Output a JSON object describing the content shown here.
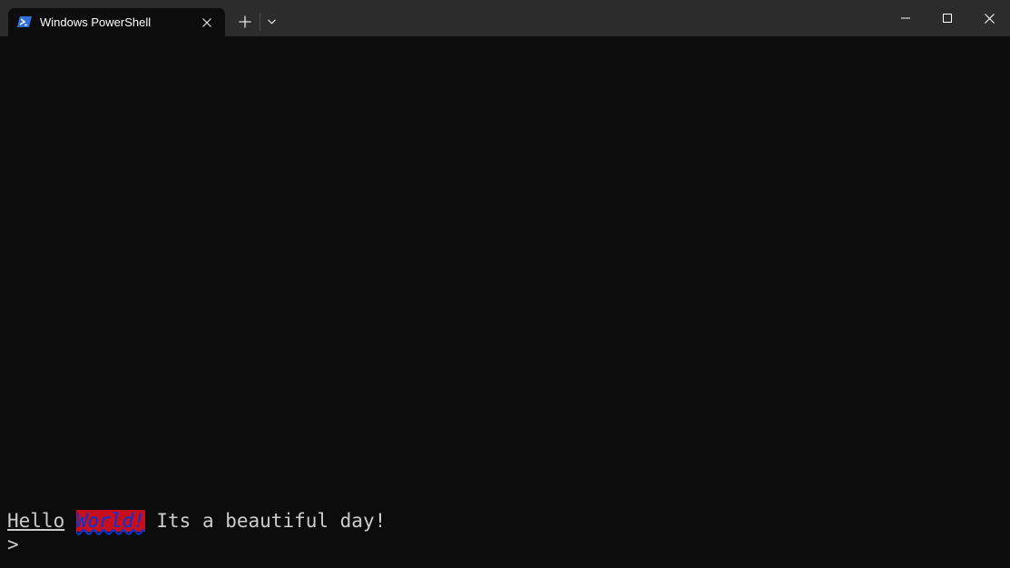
{
  "window": {
    "tab_title": "Windows PowerShell",
    "tab_icon": "powershell-icon"
  },
  "terminal": {
    "line1": {
      "hello": "Hello",
      "space1": " ",
      "world": "World!",
      "rest": " Its a beautiful day!"
    },
    "prompt": ">"
  },
  "colors": {
    "terminal_bg": "#0c0c0c",
    "titlebar_bg": "#2c2c2c",
    "text": "#cccccc",
    "highlight_bg": "#c50f1f",
    "highlight_fg": "#0037da"
  }
}
